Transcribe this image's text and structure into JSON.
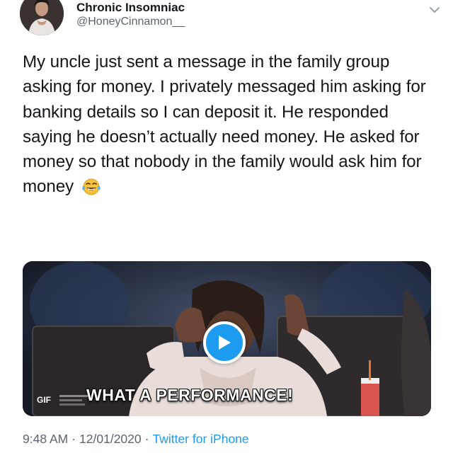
{
  "author": {
    "display_name": "Chronic Insomniac",
    "handle": "@HoneyCinnamon__",
    "avatar_icon": "profile-photo"
  },
  "tweet": {
    "text": "My uncle just sent a message in the family group asking for money. I privately messaged him asking for banking details so I can deposit it. He responded saying he doesn’t actually need money. He asked for money so that nobody in the family would ask him for money",
    "emoji": "😂",
    "emoji_icon": "face-with-tears-of-joy-icon"
  },
  "media": {
    "type_badge": "GIF",
    "caption": "WHAT A PERFORMANCE!",
    "play_icon": "play-icon"
  },
  "meta": {
    "time": "9:48 AM",
    "date": "12/01/2020",
    "separator": "·",
    "source": "Twitter for iPhone"
  },
  "colors": {
    "link_blue": "#1d9bf0",
    "secondary_text": "#5b6570",
    "primary_text": "#14171a"
  }
}
